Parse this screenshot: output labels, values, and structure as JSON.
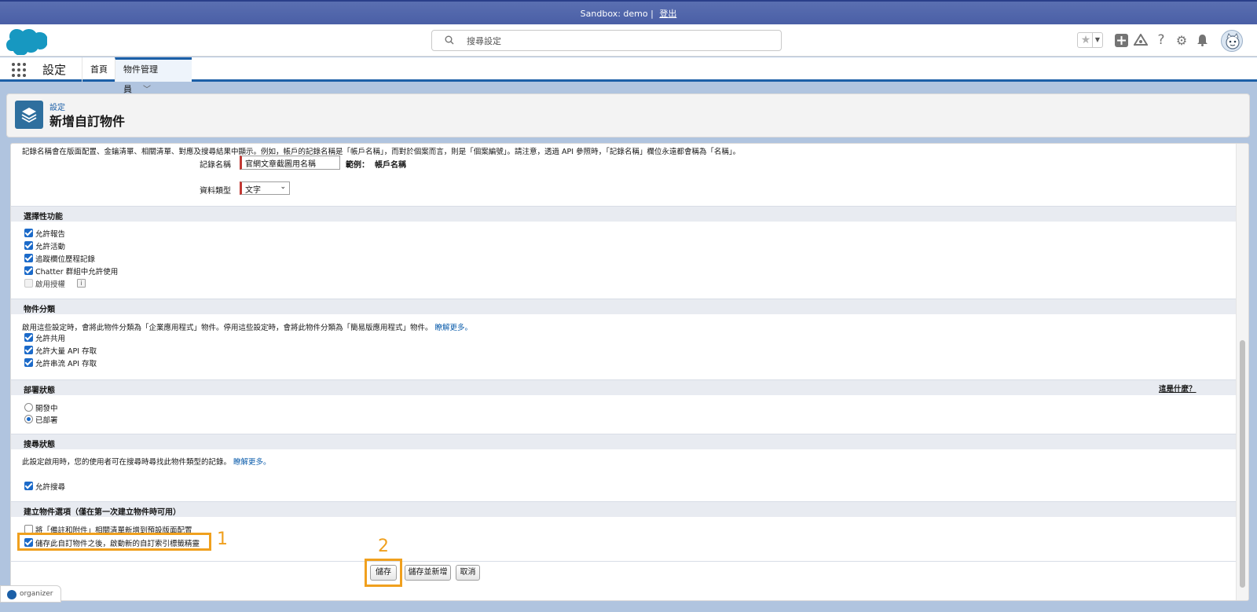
{
  "sandbox": {
    "label": "Sandbox: demo |",
    "logout": "登出"
  },
  "header": {
    "search_placeholder": "搜尋設定",
    "icons": [
      "favorites-star-icon",
      "add-icon",
      "trailhead-icon",
      "help-icon",
      "settings-gear-icon",
      "notifications-bell-icon"
    ]
  },
  "context": {
    "app_name": "設定",
    "tabs": [
      {
        "label": "首頁"
      },
      {
        "label": "物件管理員"
      }
    ]
  },
  "page": {
    "breadcrumb": "設定",
    "title": "新增自訂物件"
  },
  "form": {
    "intro": "記錄名稱會在版面配置、金鑰清單、相關清單、對應及搜尋結果中顯示。例如，帳戶的記錄名稱是「帳戶名稱」，而對於個案而言，則是「個案編號」。請注意，透過 API 參照時，「記錄名稱」欄位永遠都會稱為「名稱」。",
    "record_name_label": "記錄名稱",
    "record_name_value": "官網文章截圖用名稱",
    "example_label": "範例：",
    "example_value": "帳戶名稱",
    "data_type_label": "資料類型",
    "data_type_value": "文字"
  },
  "sections": {
    "optional_features": {
      "title": "選擇性功能",
      "items": [
        {
          "label": "允許報告",
          "checked": true
        },
        {
          "label": "允許活動",
          "checked": true
        },
        {
          "label": "追蹤欄位歷程記錄",
          "checked": true
        },
        {
          "label": "Chatter 群組中允許使用",
          "checked": true
        },
        {
          "label": "啟用授權",
          "checked": false,
          "disabled": true
        }
      ]
    },
    "classification": {
      "title": "物件分類",
      "desc": "啟用這些設定時，會將此物件分類為「企業應用程式」物件。停用這些設定時，會將此物件分類為「簡易版應用程式」物件。",
      "learn_more": "瞭解更多。",
      "items": [
        {
          "label": "允許共用",
          "checked": true
        },
        {
          "label": "允許大量 API 存取",
          "checked": true
        },
        {
          "label": "允許串流 API 存取",
          "checked": true
        }
      ]
    },
    "deployment": {
      "title": "部署狀態",
      "whats_this": "這是什麼？",
      "options": [
        {
          "label": "開發中",
          "selected": false
        },
        {
          "label": "已部署",
          "selected": true
        }
      ]
    },
    "search": {
      "title": "搜尋狀態",
      "desc": "此設定啟用時，您的使用者可在搜尋時尋找此物件類型的記錄。",
      "learn_more": "瞭解更多。",
      "items": [
        {
          "label": "允許搜尋",
          "checked": true
        }
      ]
    },
    "create_options": {
      "title": "建立物件選項（僅在第一次建立物件時可用）",
      "items": [
        {
          "label": "將「備註和附件」相關清單新增到預設版面配置",
          "checked": false
        },
        {
          "label": "儲存此自訂物件之後，啟動新的自訂索引標籤精靈",
          "checked": true
        }
      ]
    }
  },
  "buttons": {
    "save": "儲存",
    "save_new": "儲存並新增",
    "cancel": "取消"
  },
  "annotations": {
    "one": "1",
    "two": "2"
  },
  "organizer": {
    "label": "organizer"
  },
  "colors": {
    "brand": "#1b5fa7",
    "highlight": "#f0a01e",
    "sandbox_bar": "#5a6fb1"
  }
}
